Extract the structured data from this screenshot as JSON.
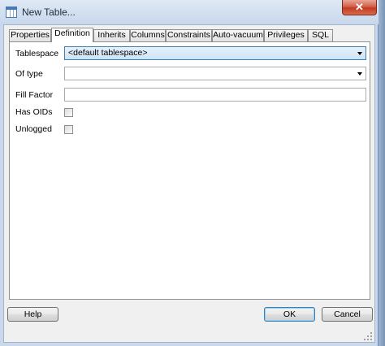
{
  "window": {
    "title": "New Table..."
  },
  "tabs": [
    {
      "label": "Properties"
    },
    {
      "label": "Definition"
    },
    {
      "label": "Inherits"
    },
    {
      "label": "Columns"
    },
    {
      "label": "Constraints"
    },
    {
      "label": "Auto-vacuum"
    },
    {
      "label": "Privileges"
    },
    {
      "label": "SQL"
    }
  ],
  "active_tab": "Definition",
  "form": {
    "tablespace_label": "Tablespace",
    "tablespace_value": "<default tablespace>",
    "of_type_label": "Of type",
    "of_type_value": "",
    "fill_factor_label": "Fill Factor",
    "fill_factor_value": "",
    "has_oids_label": "Has OIDs",
    "has_oids_checked": false,
    "unlogged_label": "Unlogged",
    "unlogged_checked": false
  },
  "buttons": {
    "help": "Help",
    "ok": "OK",
    "cancel": "Cancel"
  },
  "close_glyph": "✕",
  "icons": [
    "table-icon",
    "close-icon",
    "chevron-down-icon",
    "resize-grip-icon"
  ]
}
